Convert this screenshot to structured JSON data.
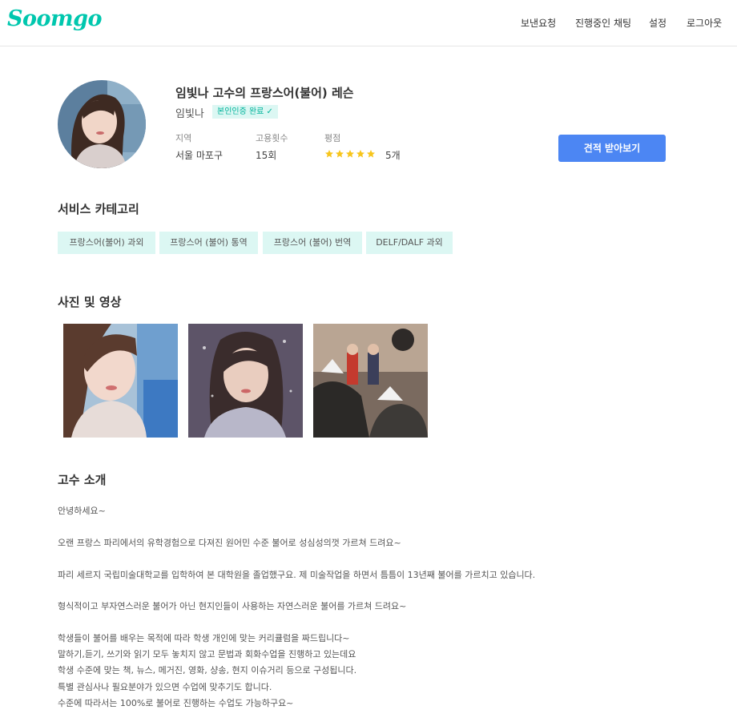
{
  "header": {
    "logo": "Soomgo",
    "nav": [
      "보낸요청",
      "진행중인 채팅",
      "설정",
      "로그아웃"
    ]
  },
  "profile": {
    "title": "임빛나 고수의 프랑스어(불어) 레슨",
    "name": "임빛나",
    "verified_badge": "본인인증 완료 ✓",
    "stats": {
      "region_label": "지역",
      "region_value": "서울 마포구",
      "hires_label": "고용횟수",
      "hires_value": "15회",
      "rating_label": "평점",
      "rating_stars": 5,
      "rating_count": "5개"
    },
    "cta_label": "견적 받아보기"
  },
  "services": {
    "heading": "서비스 카테고리",
    "chips": [
      "프랑스어(불어) 과외",
      "프랑스어 (불어) 통역",
      "프랑스어 (불어) 번역",
      "DELF/DALF 과외"
    ]
  },
  "media": {
    "heading": "사진 및 영상",
    "photos": [
      "photo-portrait-1",
      "photo-portrait-2",
      "photo-class"
    ]
  },
  "intro": {
    "heading": "고수 소개",
    "lines": [
      "안녕하세요~",
      "오랜 프랑스 파리에서의 유학경험으로 다져진 원어민 수준 불어로 성심성의껏 가르쳐 드려요~",
      "파리 세르지 국립미술대학교를 입학하여 본 대학원을 졸업했구요. 제 미술작업을 하면서 틈틈이 13년째 불어를 가르치고 있습니다.",
      "형식적이고 부자연스러운 불어가 아닌 현지인들이 사용하는 자연스러운 불어를 가르쳐 드려요~",
      "학생들이 불어를 배우는 목적에 따라 학생 개인에 맞는 커리큘럼을 짜드립니다~",
      "말하기,듣기, 쓰기와 읽기 모두 놓치지 않고 문법과 회화수업을 진행하고 있는데요",
      "학생 수준에 맞는 책, 뉴스, 메거진, 영화, 샹송, 현지 이슈거리 등으로 구성됩니다.",
      "특별 관심사나 필요분야가 있으면 수업에 맞추기도 합니다.",
      "수준에 따라서는 100%로 불어로 진행하는 수업도 가능하구요~"
    ]
  },
  "colors": {
    "brand": "#00c7ae",
    "cta": "#4c86f3",
    "chip_bg": "#dcf7f3",
    "star": "#f7c51c"
  }
}
